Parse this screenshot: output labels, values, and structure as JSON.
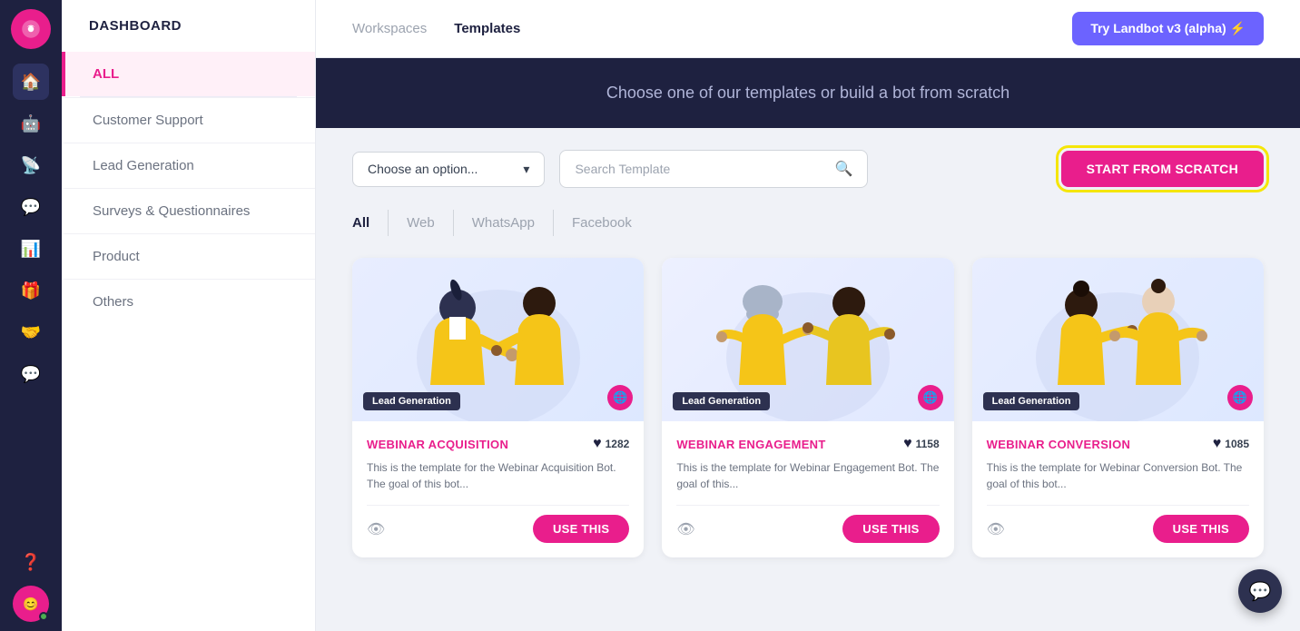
{
  "iconBar": {
    "logoAlt": "Landbot logo"
  },
  "sidebar": {
    "title": "DASHBOARD",
    "items": [
      {
        "id": "all",
        "label": "ALL",
        "active": true
      },
      {
        "id": "customer-support",
        "label": "Customer Support",
        "active": false
      },
      {
        "id": "lead-generation",
        "label": "Lead Generation",
        "active": false
      },
      {
        "id": "surveys",
        "label": "Surveys & Questionnaires",
        "active": false
      },
      {
        "id": "product",
        "label": "Product",
        "active": false
      },
      {
        "id": "others",
        "label": "Others",
        "active": false
      }
    ]
  },
  "topNav": {
    "links": [
      {
        "id": "workspaces",
        "label": "Workspaces",
        "active": false
      },
      {
        "id": "templates",
        "label": "Templates",
        "active": true
      }
    ],
    "tryBtn": "Try Landbot v3 (alpha) ⚡"
  },
  "hero": {
    "text": "Choose one of our templates or build a bot from scratch"
  },
  "filters": {
    "selectPlaceholder": "Choose an option...",
    "searchPlaceholder": "Search Template",
    "startFromScratch": "START FROM SCRATCH"
  },
  "typeTabs": [
    {
      "id": "all",
      "label": "All",
      "active": true
    },
    {
      "id": "web",
      "label": "Web",
      "active": false
    },
    {
      "id": "whatsapp",
      "label": "WhatsApp",
      "active": false
    },
    {
      "id": "facebook",
      "label": "Facebook",
      "active": false
    }
  ],
  "cards": [
    {
      "id": "webinar-acquisition",
      "tag": "Lead Generation",
      "platform": "🌐",
      "title": "WEBINAR ACQUISITION",
      "likes": "1282",
      "description": "This is the template for the Webinar Acquisition Bot. The goal of this bot...",
      "useBtn": "USE THIS",
      "bgColor1": "#e8edff",
      "bgColor2": "#dde6ff"
    },
    {
      "id": "webinar-engagement",
      "tag": "Lead Generation",
      "platform": "🌐",
      "title": "WEBINAR ENGAGEMENT",
      "likes": "1158",
      "description": "This is the template for Webinar Engagement Bot. The goal of this...",
      "useBtn": "USE THIS",
      "bgColor1": "#edf0ff",
      "bgColor2": "#e0e8ff"
    },
    {
      "id": "webinar-conversion",
      "tag": "Lead Generation",
      "platform": "🌐",
      "title": "WEBINAR CONVERSION",
      "likes": "1085",
      "description": "This is the template for Webinar Conversion Bot. The goal of this bot...",
      "useBtn": "USE THIS",
      "bgColor1": "#e8edff",
      "bgColor2": "#dde6ff"
    }
  ]
}
